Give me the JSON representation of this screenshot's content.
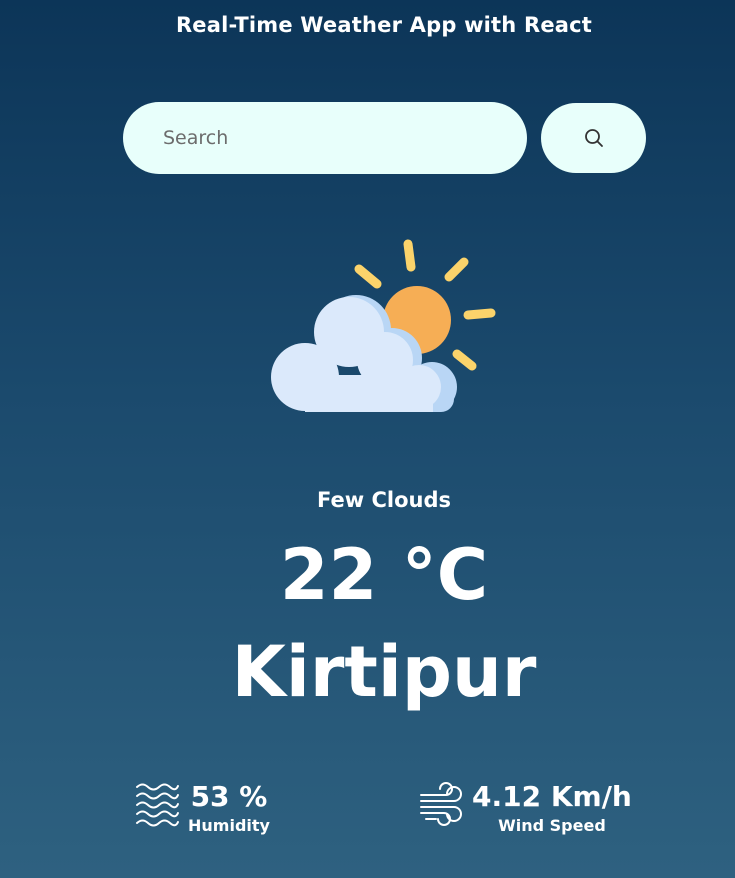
{
  "app": {
    "title": "Real-Time Weather App with React"
  },
  "search": {
    "placeholder": "Search",
    "value": "",
    "button_icon": "search-icon"
  },
  "weather": {
    "icon": "partly-cloudy-day-icon",
    "condition": "Few Clouds",
    "temperature": "22 °C",
    "city": "Kirtipur"
  },
  "stats": {
    "humidity": {
      "icon": "humidity-waves-icon",
      "value": "53 %",
      "label": "Humidity"
    },
    "wind": {
      "icon": "wind-icon",
      "value": "4.12 Km/h",
      "label": "Wind Speed"
    }
  },
  "colors": {
    "background_top": "#0c3558",
    "background_bottom": "#2e6180",
    "search_bg": "#e8fffb",
    "sun": "#f6ae55",
    "sun_rays": "#fbd36b",
    "cloud": "#dbe9fb",
    "cloud_shadow": "#b9d6f5"
  }
}
